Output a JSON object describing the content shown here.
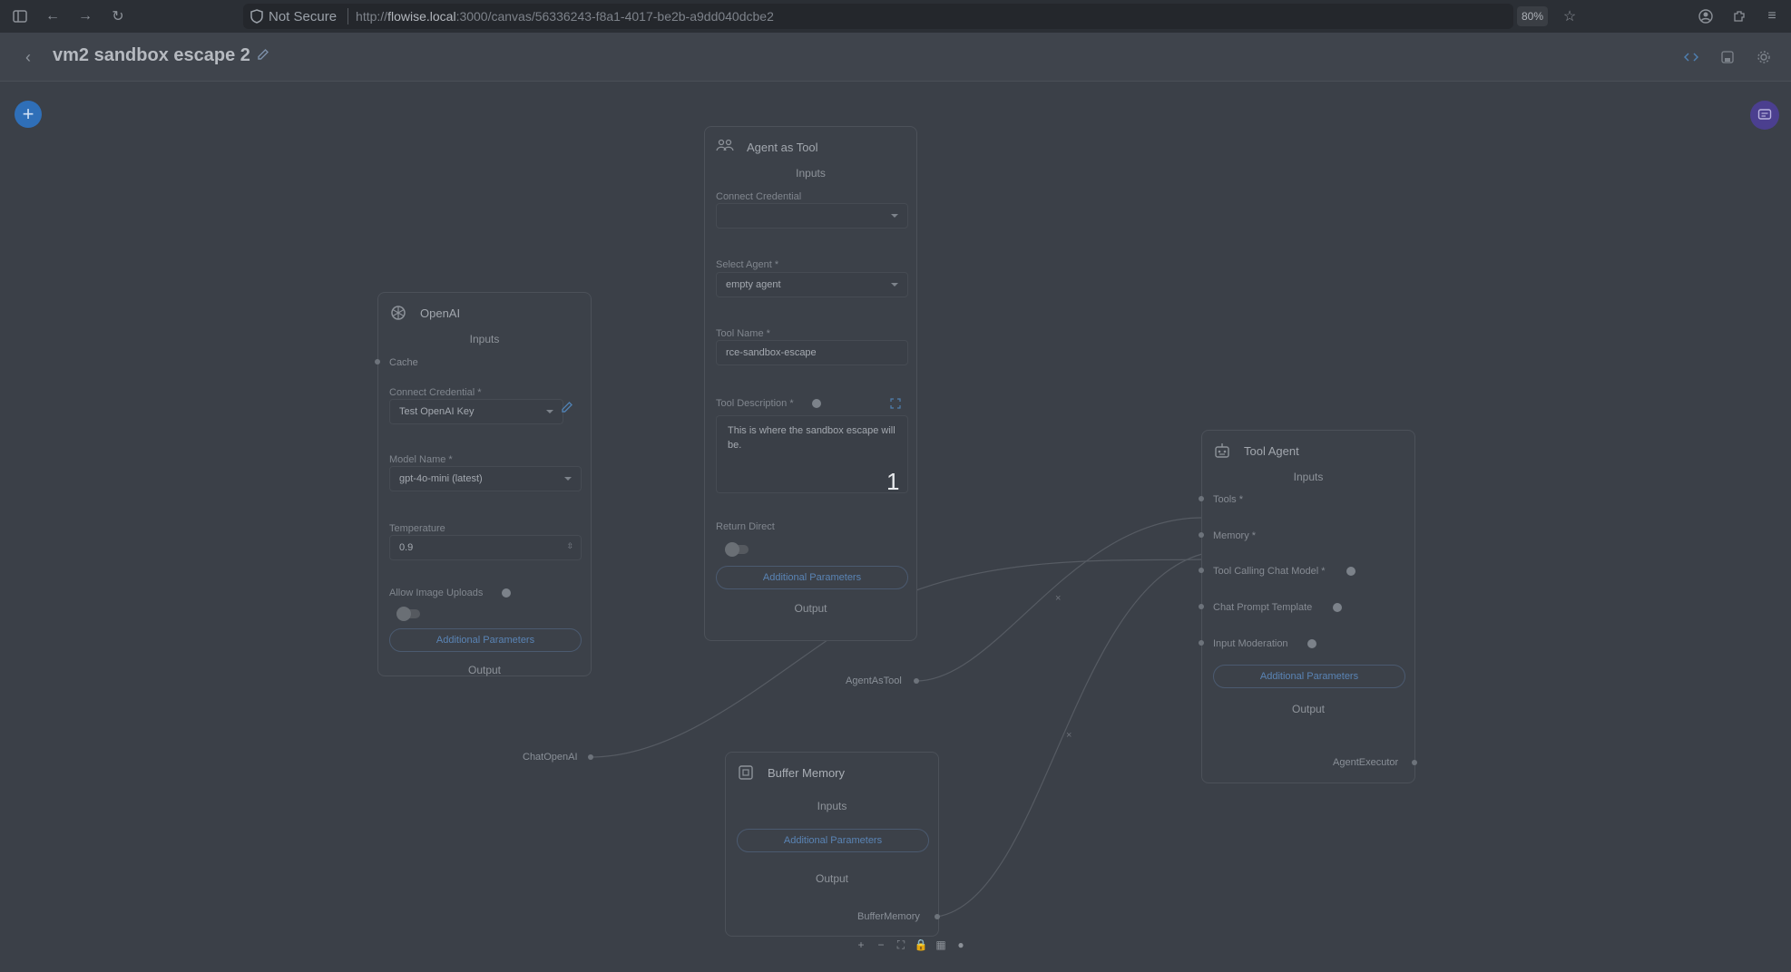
{
  "browser": {
    "not_secure": "Not Secure",
    "url_scheme": "http://",
    "url_host": "flowise.local",
    "url_path": ":3000/canvas/56336243-f8a1-4017-be2b-a9dd040dcbe2",
    "zoom": "80%"
  },
  "header": {
    "title": "vm2 sandbox escape 2"
  },
  "nodes": {
    "openai": {
      "title": "OpenAI",
      "inputs_label": "Inputs",
      "cache_label": "Cache",
      "credential_label": "Connect Credential *",
      "credential_value": "Test OpenAI Key",
      "model_label": "Model Name *",
      "model_value": "gpt-4o-mini (latest)",
      "temperature_label": "Temperature",
      "temperature_value": "0.9",
      "image_uploads_label": "Allow Image Uploads",
      "additional_params": "Additional Parameters",
      "output_label": "Output",
      "output_handle": "ChatOpenAI"
    },
    "agent_tool": {
      "title": "Agent as Tool",
      "inputs_label": "Inputs",
      "credential_label": "Connect Credential",
      "credential_value": "",
      "agent_label": "Select Agent *",
      "agent_value": "empty agent",
      "tool_name_label": "Tool Name *",
      "tool_name_value": "rce-sandbox-escape",
      "tool_desc_label": "Tool Description *",
      "tool_desc_value": "This is where the sandbox escape will be.",
      "overlay_number": "1",
      "return_direct_label": "Return Direct",
      "additional_params": "Additional Parameters",
      "output_label": "Output",
      "output_handle": "AgentAsTool"
    },
    "buffer_memory": {
      "title": "Buffer Memory",
      "inputs_label": "Inputs",
      "additional_params": "Additional Parameters",
      "output_label": "Output",
      "output_handle": "BufferMemory"
    },
    "tool_agent": {
      "title": "Tool Agent",
      "inputs_label": "Inputs",
      "tools_label": "Tools *",
      "memory_label": "Memory *",
      "chat_model_label": "Tool Calling Chat Model *",
      "prompt_label": "Chat Prompt Template",
      "moderation_label": "Input Moderation",
      "additional_params": "Additional Parameters",
      "output_label": "Output",
      "output_handle": "AgentExecutor"
    }
  },
  "controls": [
    "+",
    "−",
    "⛶",
    "🔒",
    "▦",
    "●"
  ],
  "colors": {
    "canvas_bg": "#3b4048",
    "accent_blue": "#2f6fb8",
    "chat_purple": "#4b3f8f"
  }
}
